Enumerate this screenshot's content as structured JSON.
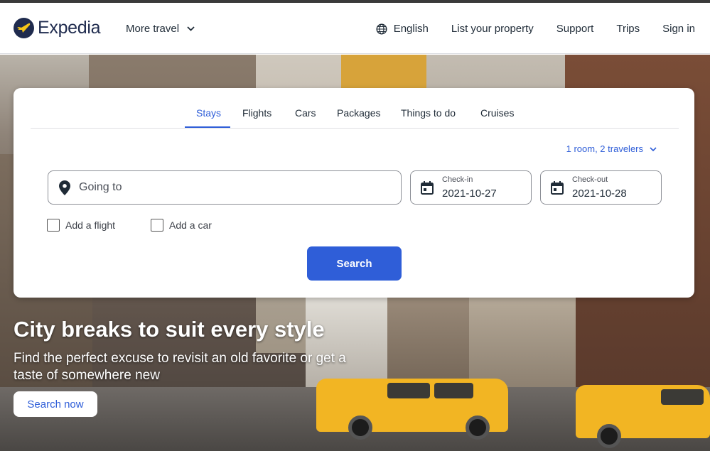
{
  "header": {
    "brand": "Expedia",
    "more_travel": "More travel",
    "language": "English",
    "list_property": "List your property",
    "support": "Support",
    "trips": "Trips",
    "sign_in": "Sign in"
  },
  "search_card": {
    "tabs": [
      {
        "label": "Stays",
        "active": true
      },
      {
        "label": "Flights",
        "active": false
      },
      {
        "label": "Cars",
        "active": false
      },
      {
        "label": "Packages",
        "active": false
      },
      {
        "label": "Things to do",
        "active": false
      },
      {
        "label": "Cruises",
        "active": false
      }
    ],
    "travelers": "1 room, 2 travelers",
    "going_to_placeholder": "Going to",
    "checkin_label": "Check-in",
    "checkin_value": "2021-10-27",
    "checkout_label": "Check-out",
    "checkout_value": "2021-10-28",
    "add_flight": "Add a flight",
    "add_car": "Add a car",
    "search_button": "Search"
  },
  "hero": {
    "title": "City breaks to suit every style",
    "subtitle": "Find the perfect excuse to revisit an old favorite or get a taste of somewhere new",
    "cta": "Search now"
  },
  "colors": {
    "accent": "#2f5ed8",
    "brand_navy": "#1f2b4e",
    "taxi_yellow": "#f2b523"
  },
  "icons": [
    "plane-logo-icon",
    "chevron-down-icon",
    "globe-icon",
    "map-pin-icon",
    "calendar-icon",
    "checkbox-icon"
  ]
}
